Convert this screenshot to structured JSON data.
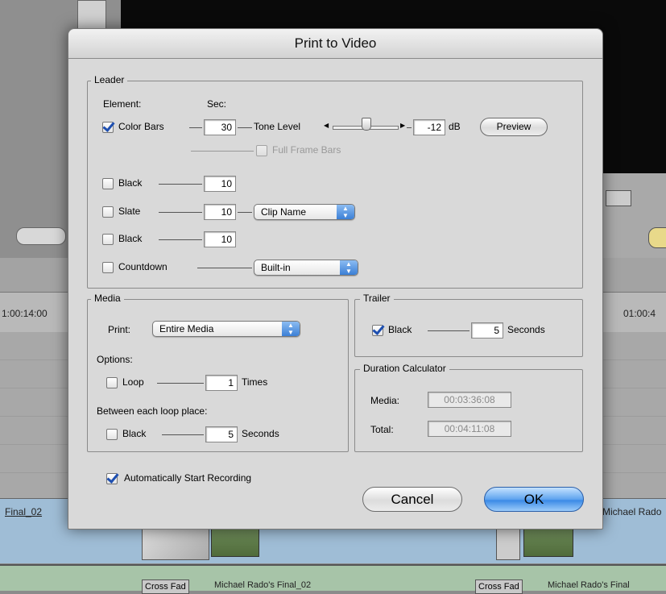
{
  "dialog": {
    "title": "Print to Video"
  },
  "leader": {
    "group_label": "Leader",
    "element_header": "Element:",
    "sec_header": "Sec:",
    "color_bars": {
      "label": "Color Bars",
      "checked": true,
      "seconds": "30"
    },
    "tone_level": {
      "label": "Tone Level",
      "value": "-12",
      "unit": "dB"
    },
    "preview_label": "Preview",
    "full_frame_bars": {
      "label": "Full Frame Bars",
      "checked": false
    },
    "black1": {
      "label": "Black",
      "checked": false,
      "seconds": "10"
    },
    "slate": {
      "label": "Slate",
      "checked": false,
      "seconds": "10",
      "source": "Clip Name"
    },
    "black2": {
      "label": "Black",
      "checked": false,
      "seconds": "10"
    },
    "countdown": {
      "label": "Countdown",
      "checked": false,
      "type": "Built-in"
    }
  },
  "media": {
    "group_label": "Media",
    "print_label": "Print:",
    "print_value": "Entire Media",
    "options_label": "Options:",
    "loop": {
      "label": "Loop",
      "checked": false,
      "value": "1",
      "unit": "Times"
    },
    "between_label": "Between each loop place:",
    "black": {
      "label": "Black",
      "checked": false,
      "value": "5",
      "unit": "Seconds"
    }
  },
  "trailer": {
    "group_label": "Trailer",
    "black": {
      "label": "Black",
      "checked": true,
      "value": "5",
      "unit": "Seconds"
    }
  },
  "duration": {
    "group_label": "Duration Calculator",
    "media_label": "Media:",
    "media_value": "00:03:36:08",
    "total_label": "Total:",
    "total_value": "00:04:11:08"
  },
  "auto_record": {
    "label": "Automatically Start Recording",
    "checked": true
  },
  "buttons": {
    "cancel": "Cancel",
    "ok": "OK"
  },
  "background": {
    "timecode_left": "1:00:14:00",
    "timecode_right": "01:00:4",
    "clip_left": "Final_02",
    "clip_right": "Michael Rado",
    "transition1": "Cross Fad",
    "clip_bottom1": "Michael Rado's Final_02",
    "transition2": "Cross Fad",
    "clip_bottom2": "Michael Rado's Final"
  }
}
